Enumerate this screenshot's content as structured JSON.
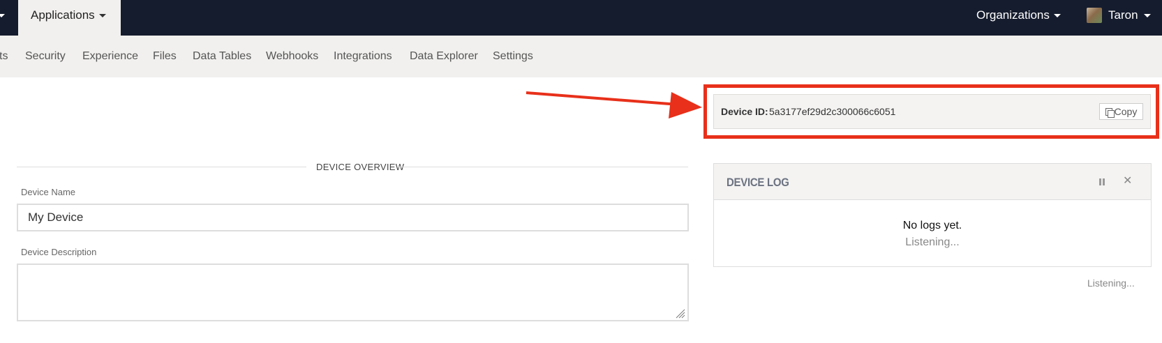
{
  "topbar": {
    "applications_label": "Applications",
    "organizations_label": "Organizations",
    "user_name": "Taron"
  },
  "subnav": {
    "items": [
      "ts",
      "Security",
      "Experience",
      "Files",
      "Data Tables",
      "Webhooks",
      "Integrations",
      "Data Explorer",
      "Settings"
    ]
  },
  "device_id": {
    "label": "Device ID:",
    "value": "5a3177ef29d2c300066c6051",
    "copy_label": "Copy"
  },
  "overview": {
    "title": "DEVICE OVERVIEW",
    "name_label": "Device Name",
    "name_value": "My Device",
    "description_label": "Device Description",
    "description_value": ""
  },
  "device_log": {
    "title": "DEVICE LOG",
    "empty_text": "No logs yet.",
    "status_text": "Listening...",
    "footer_status": "Listening..."
  },
  "colors": {
    "topbar": "#151c2e",
    "subnav": "#f1f0ee",
    "highlight": "#e8301a"
  }
}
